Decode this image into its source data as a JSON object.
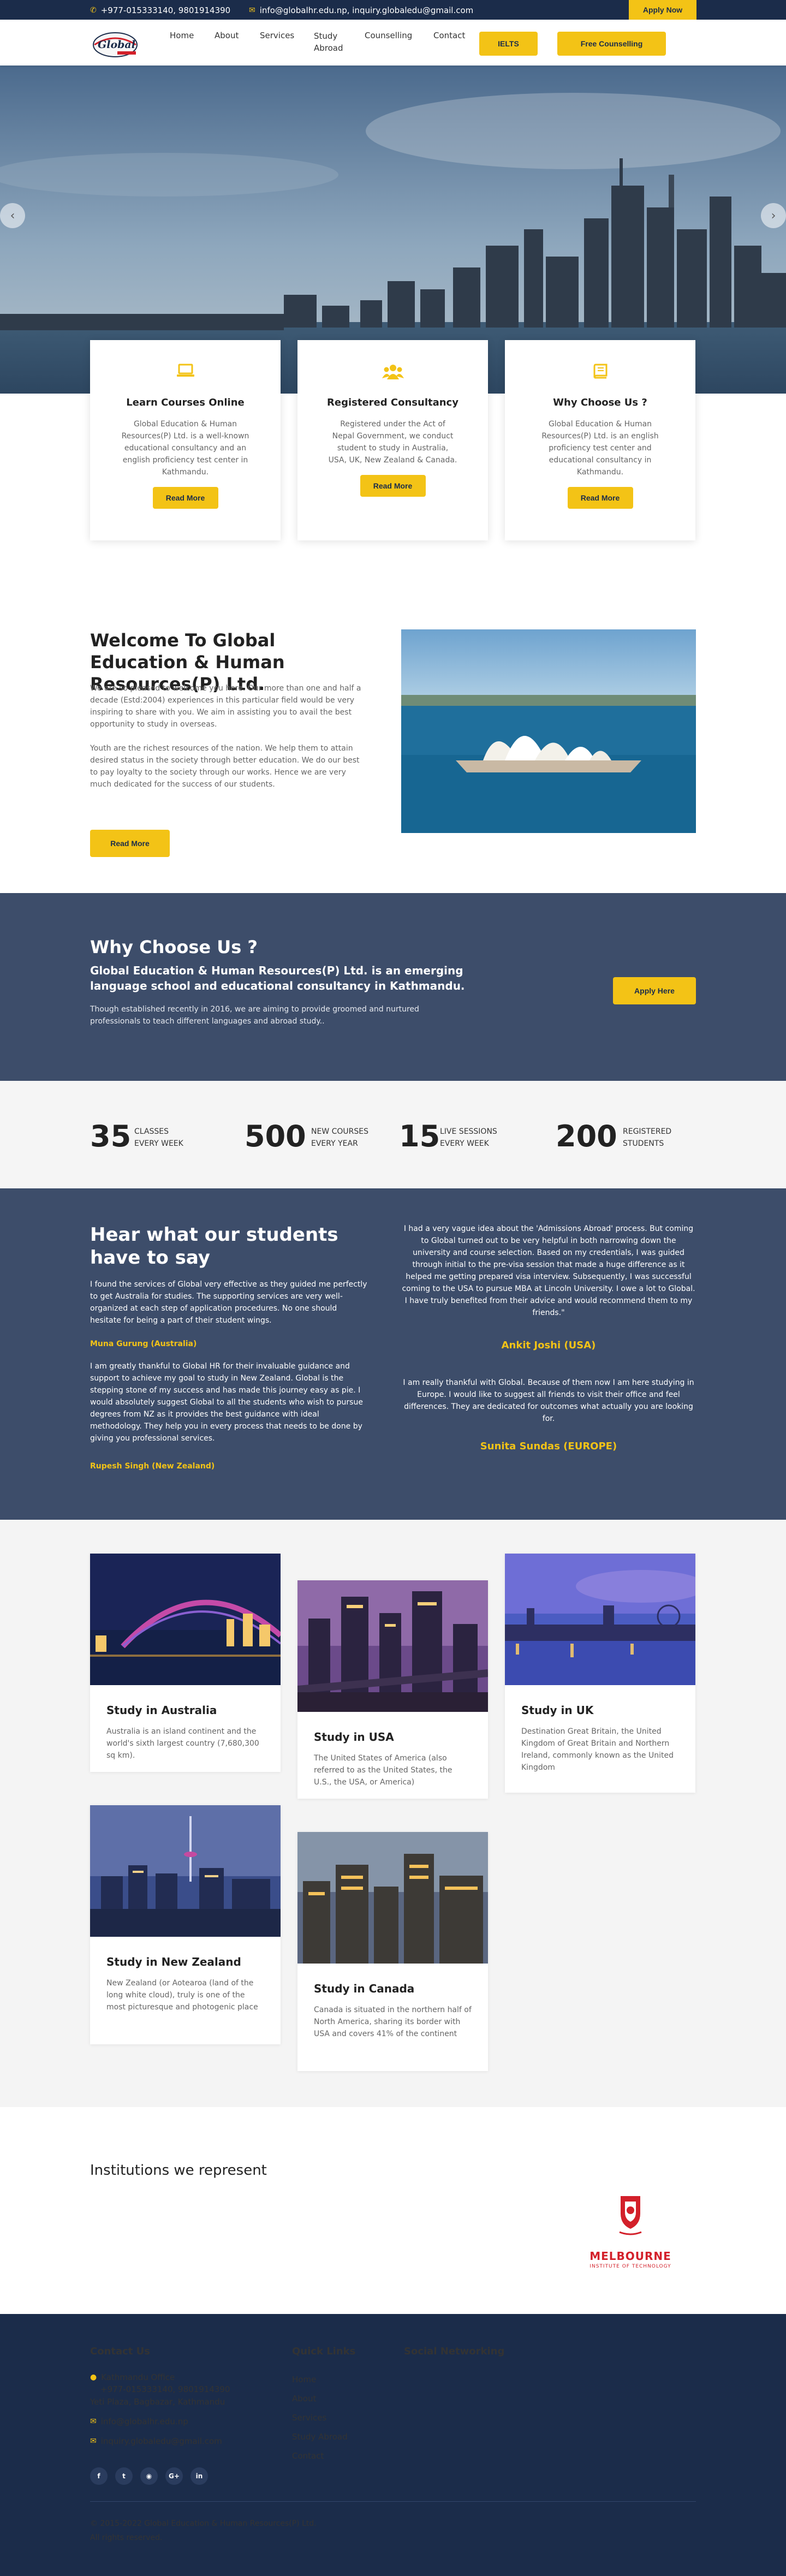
{
  "topbar": {
    "phone": "+977-015333140, 9801914390",
    "email": "info@globalhr.edu.np, inquiry.globaledu@gmail.com",
    "apply_label": "Apply Now"
  },
  "brand": {
    "logo_text": "Global"
  },
  "nav": {
    "home": "Home",
    "about": "About",
    "services": "Services",
    "study_abroad_1": "Study",
    "study_abroad_2": "Abroad",
    "counselling": "Counselling",
    "contact": "Contact",
    "ielts": "IELTS",
    "free_counselling": "Free Counselling"
  },
  "features": [
    {
      "icon": "laptop-icon",
      "title": "Learn Courses Online",
      "text": "Global Education & Human Resources(P) Ltd. is a well-known educational consultancy and an english proficiency test center in Kathmandu.",
      "button": "Read More"
    },
    {
      "icon": "users-icon",
      "title": "Registered Consultancy",
      "text": "Registered under the Act of Nepal Government, we conduct student to study in Australia, USA, UK, New Zealand & Canada.",
      "button": "Read More"
    },
    {
      "icon": "book-icon",
      "title": "Why Choose Us ?",
      "text": "Global Education & Human Resources(P) Ltd. is an english proficiency test center and educational consultancy in Kathmandu.",
      "button": "Read More"
    }
  ],
  "welcome": {
    "title": "Welcome To Global Education & Human Resources(P) Ltd.",
    "p1": "We are so pleased to welcome you here. Our more than one and half a decade (Estd:2004) experiences in this particular field would be very inspiring to share with you. We aim in assisting you to avail the best opportunity to study in overseas.",
    "p2": "Youth are the richest resources of the nation. We help them to attain desired status in the society through better education. We do our best to pay loyalty to the society through our works. Hence we are very much dedicated for the success of our students.",
    "button": "Read More"
  },
  "why": {
    "title": "Why Choose Us ?",
    "subtitle": "Global Education & Human Resources(P) Ltd. is an emerging language school and educational consultancy in Kathmandu.",
    "text": "Though established recently in 2016, we are aiming to provide groomed and nurtured professionals to teach different languages and abroad study..",
    "button": "Apply Here"
  },
  "stats": [
    {
      "value": "35",
      "label1": "CLASSES",
      "label2": "EVERY WEEK"
    },
    {
      "value": "500",
      "label1": "NEW COURSES",
      "label2": "EVERY YEAR"
    },
    {
      "value": "15",
      "label1": "LIVE SESSIONS",
      "label2": "EVERY WEEK"
    },
    {
      "value": "200",
      "label1": "REGISTERED",
      "label2": "STUDENTS"
    }
  ],
  "testimonials": {
    "title": "Hear what our students have to say",
    "left": [
      {
        "text": "I found the services of Global very effective as they guided me perfectly to get Australia for studies. The supporting services are very well-organized at each step of application procedures. No one should hesitate for being a part of their student wings.",
        "author": "Muna Gurung (Australia)"
      },
      {
        "text": "I am greatly thankful to Global HR for their invaluable guidance and support to achieve my goal to study in New Zealand. Global is the stepping stone of my success and has made this journey easy as pie. I would absolutely suggest Global to all the students who wish to pursue degrees from NZ as it provides the best guidance with ideal methodology. They help you in every process that needs to be done by giving you professional services.",
        "author": "Rupesh Singh (New Zealand)"
      }
    ],
    "right": [
      {
        "text": "I had a very vague idea about the 'Admissions Abroad' process. But coming to Global turned out to be very helpful in both narrowing down the university and course selection. Based on my credentials, I was guided through initial to the pre-visa session that made a huge difference as it helped me getting prepared visa interview. Subsequently, I was successful coming to the USA to pursue MBA at Lincoln University. I owe a lot to Global. I have truly benefited from their advice and would recommend them to my friends.\"",
        "author": "Ankit Joshi (USA)"
      },
      {
        "text": "I am really thankful with Global. Because of them now I am here studying in Europe. I would like to suggest all friends to visit their office and feel differences. They are dedicated for outcomes what actually you are looking for.",
        "author": "Sunita Sundas (EUROPE)"
      }
    ]
  },
  "destinations": [
    {
      "title": "Study in Australia",
      "text": "Australia is an island continent and the world's sixth largest country (7,680,300 sq km)."
    },
    {
      "title": "Study in USA",
      "text": "The United States of America (also referred to as the United States, the U.S., the USA, or America)"
    },
    {
      "title": "Study in UK",
      "text": "Destination Great Britain, the United Kingdom of Great Britain and Northern Ireland, commonly known as the United Kingdom"
    },
    {
      "title": "Study in New Zealand",
      "text": "New Zealand (or Aotearoa (land of the long white cloud), truly is one of the most picturesque and photogenic place"
    },
    {
      "title": "Study in Canada",
      "text": "Canada is situated in the northern half of North America, sharing its border with USA and covers 41% of the continent"
    }
  ],
  "institutions": {
    "title": "Institutions we represent",
    "logo_name": "MELBOURNE",
    "logo_sub": "INSTITUTE OF TECHNOLOGY"
  },
  "footer": {
    "contact_title": "Contact Us",
    "office": "Kathmandu Office",
    "phone": "+977-015333140, 9801914390",
    "address": "Yeti Plaza, Bagbazar, Kathmandu",
    "email1": "info@globalhr.edu.np",
    "email2": "inquiry.globaledu@gmail.com",
    "links_title": "Quick Links",
    "links": [
      "Home",
      "About",
      "Services",
      "Study Abroad",
      "Contact"
    ],
    "social_title": "Social Networking",
    "copyright1": "© 2015-2022 Global Education & Human Resources(P) Ltd.",
    "copyright2": "All rights reserved."
  },
  "colors": {
    "accent": "#f3c316",
    "navy": "#1b2c4a",
    "slate": "#3d4d6a"
  }
}
